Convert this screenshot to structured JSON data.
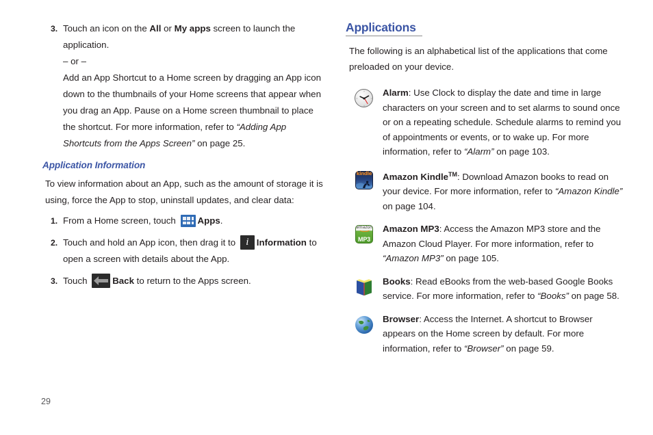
{
  "page_number": "29",
  "left_column": {
    "step3_top": {
      "number": "3.",
      "line1_pre": "Touch an icon on the ",
      "line1_bold1": "All",
      "line1_mid": " or ",
      "line1_bold2": "My apps",
      "line1_post": " screen to launch the application.",
      "or_separator": "– or –",
      "alt_pre": "Add an App Shortcut to a Home screen by dragging an App icon down to the thumbnails of your Home screens that appear when you drag an App. Pause on a Home screen thumbnail to place the shortcut. For more information, refer to ",
      "alt_ref": "“Adding App Shortcuts from the Apps Screen”",
      "alt_post": " on page 25."
    },
    "subheading": "Application Information",
    "intro": "To view information about an App, such as the amount of storage it is using, force the App to stop, uninstall updates, and clear data:",
    "steps": [
      {
        "number": "1.",
        "pre": "From a Home screen, touch ",
        "icon": "apps-grid-icon",
        "bold": "Apps",
        "post": "."
      },
      {
        "number": "2.",
        "pre": "Touch and hold an App icon, then drag it to ",
        "icon": "information-icon",
        "bold": "Information",
        "post": " to open a screen with details about the App."
      },
      {
        "number": "3.",
        "pre": "Touch ",
        "icon": "back-arrow-icon",
        "bold": "Back",
        "post": " to return to the Apps screen."
      }
    ]
  },
  "right_column": {
    "heading": "Applications",
    "intro": "The following is an alphabetical list of the applications that come preloaded on your device.",
    "apps": [
      {
        "icon": "alarm-clock-icon",
        "name": "Alarm",
        "body_pre": ": Use Clock to display the date and time in large characters on your screen and to set alarms to sound once or on a repeating schedule. Schedule alarms to remind you of appointments or events, or to wake up. For more information, refer to ",
        "ref": "“Alarm”",
        "body_post": " on page 103."
      },
      {
        "icon": "amazon-kindle-icon",
        "name": "Amazon Kindle",
        "superscript": "TM",
        "body_pre": ": Download Amazon books to read on your device. For more information, refer to ",
        "ref": "“Amazon Kindle”",
        "body_post": " on page 104."
      },
      {
        "icon": "amazon-mp3-icon",
        "name": "Amazon MP3",
        "body_pre": ": Access the Amazon MP3 store and the Amazon Cloud Player. For more information, refer to ",
        "ref": "“Amazon MP3”",
        "body_post": " on page 105."
      },
      {
        "icon": "books-icon",
        "name": "Books",
        "body_pre": ": Read eBooks from the web-based Google Books service. For more information, refer to ",
        "ref": "“Books”",
        "body_post": " on page 58."
      },
      {
        "icon": "browser-globe-icon",
        "name": "Browser",
        "body_pre": ": Access the Internet. A shortcut to Browser appears on the Home screen by default. For more information, refer to ",
        "ref": "“Browser”",
        "body_post": " on page 59."
      }
    ]
  },
  "icon_labels": {
    "kindle_word": "kindle",
    "amazon_word": "amazon",
    "mp3_word": "MP3",
    "info_letter": "i"
  },
  "colors": {
    "heading_blue": "#3b55a5",
    "body_text": "#231f20",
    "apps_chip_blue": "#2f6bb5",
    "chip_dark": "#2b2b2b",
    "rule_gray": "#8d8d8d"
  }
}
